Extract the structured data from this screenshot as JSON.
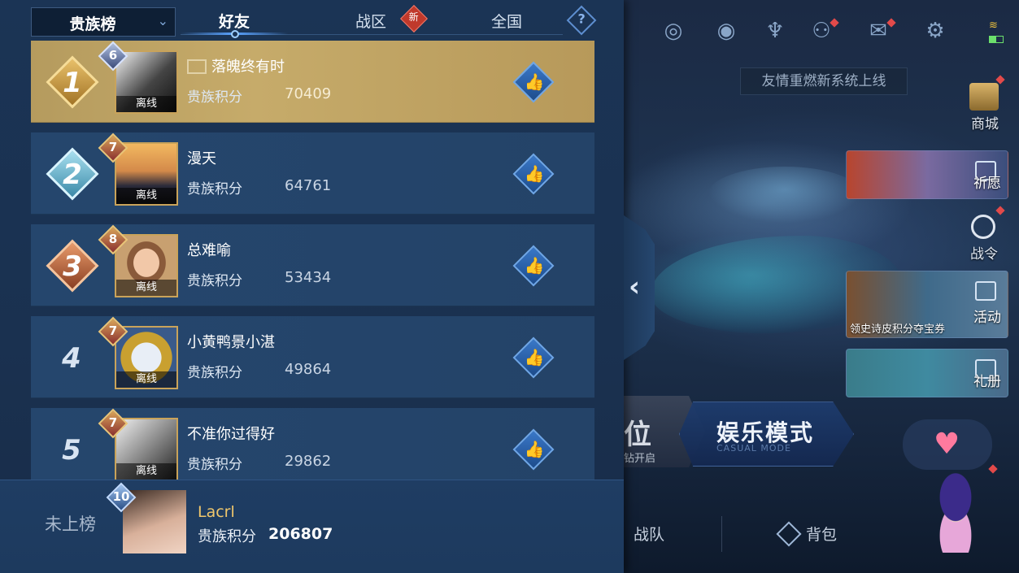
{
  "tabs": {
    "dropdown_label": "贵族榜",
    "friends": "好友",
    "region": "战区",
    "region_badge": "新",
    "national": "全国",
    "help": "?"
  },
  "leaderboard": [
    {
      "rank": "1",
      "level": "6",
      "name": "落魄终有时",
      "score_label": "贵族积分",
      "score": "70409",
      "status": "离线"
    },
    {
      "rank": "2",
      "level": "7",
      "name": "漫天",
      "score_label": "贵族积分",
      "score": "64761",
      "status": "离线"
    },
    {
      "rank": "3",
      "level": "8",
      "name": "总难喻",
      "score_label": "贵族积分",
      "score": "53434",
      "status": "离线"
    },
    {
      "rank": "4",
      "level": "7",
      "name": "小黄鸭景小湛",
      "score_label": "贵族积分",
      "score": "49864",
      "status": "离线"
    },
    {
      "rank": "5",
      "level": "7",
      "name": "不准你过得好",
      "score_label": "贵族积分",
      "score": "29862",
      "status": "离线"
    }
  ],
  "self": {
    "unranked": "未上榜",
    "level": "10",
    "name": "Lacrl",
    "score_label": "贵族积分",
    "score": "206807"
  },
  "right": {
    "notice": "友情重燃新系统上线",
    "shop": "商城",
    "wish": "祈愿",
    "battle_pass": "战令",
    "activity": "活动",
    "activity_sub": "领史诗皮积分夺宝券",
    "gift_book": "礼册",
    "rank_mode_big": "位",
    "rank_mode_small": "钻开启",
    "casual_mode": "娱乐模式",
    "casual_mode_en": "CASUAL MODE",
    "team": "战队",
    "bag": "背包"
  },
  "icons": [
    "radar-icon",
    "eye-icon",
    "trophy-icon",
    "friends-icon",
    "mail-icon",
    "settings-icon"
  ],
  "colors": {
    "gold_row": "#c6ab6a",
    "row_blue": "#25466d",
    "accent": "#5aa3ff"
  }
}
